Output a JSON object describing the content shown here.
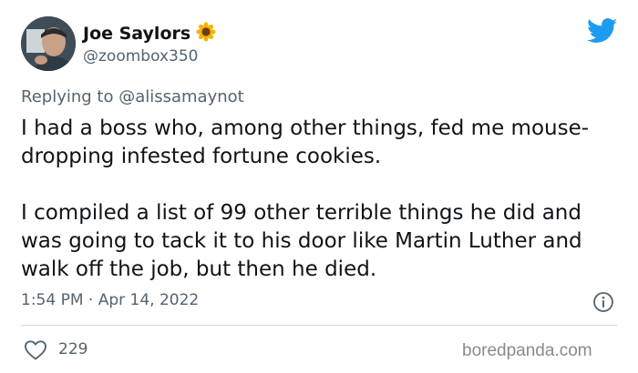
{
  "tweet": {
    "display_name": "Joe Saylors",
    "handle": "@zoombox350",
    "replying_to_prefix": "Replying to ",
    "replying_to_handle": "@alissamaynot",
    "paragraphs": [
      "I had a boss who, among other things, fed me mouse-dropping infested fortune cookies.",
      "I compiled a list of 99 other terrible things he did and was going to tack it to his door like Martin Luther and walk off the job, but then he died."
    ],
    "timestamp": "1:54 PM · Apr 14, 2022",
    "like_count": "229"
  },
  "icons": {
    "name_emoji": "sunflower-icon",
    "brand": "twitter-bird-icon",
    "info": "info-icon",
    "like": "heart-icon"
  },
  "watermark": "boredpanda.com",
  "colors": {
    "twitter_blue": "#1d9bf0",
    "text_primary": "#0f1419",
    "text_secondary": "#536471",
    "divider": "#cfd9de"
  }
}
